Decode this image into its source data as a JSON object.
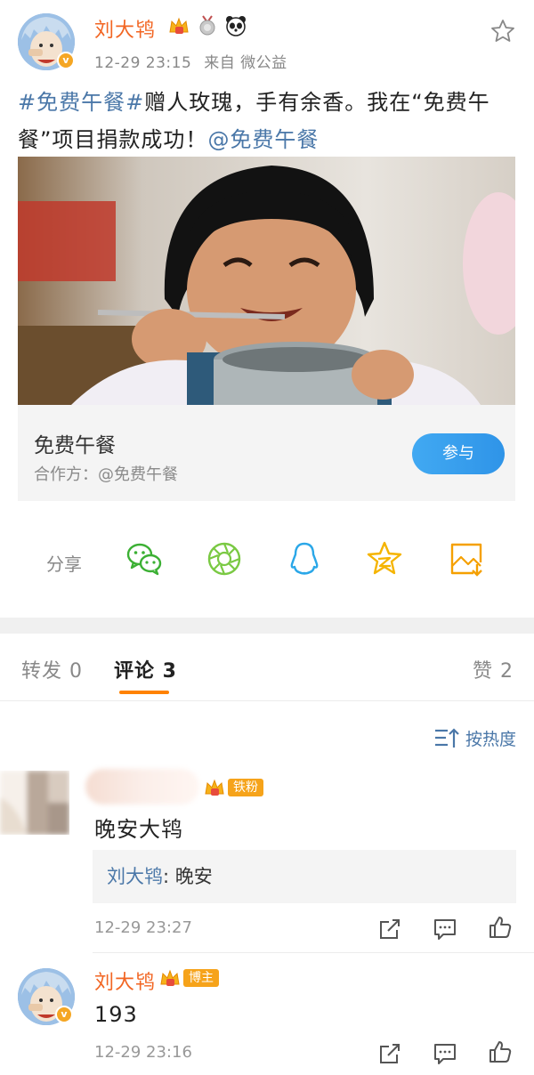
{
  "post": {
    "username": "刘大鸨",
    "time": "12-29 23:15",
    "source": "来自 微公益",
    "text_parts": {
      "tag": "#免费午餐#",
      "body": "赠人玫瑰，手有余香。我在“免费午餐”项目捐款成功！",
      "mention": "@免费午餐"
    }
  },
  "card": {
    "title": "免费午餐",
    "partner": "合作方：@免费午餐",
    "button_label": "参与"
  },
  "share": {
    "label": "分享",
    "icons": [
      "wechat-icon",
      "moments-icon",
      "qq-icon",
      "qzone-icon",
      "save-image-icon"
    ]
  },
  "tabs": {
    "repost": "转发 0",
    "comments": "评论 3",
    "likes": "赞 2"
  },
  "sort": {
    "label": "按热度"
  },
  "comments": [
    {
      "badge": "铁粉",
      "text": "晚安大鸨",
      "reply_author": "刘大鸨",
      "reply_text": ": 晚安",
      "time": "12-29 23:27"
    },
    {
      "username": "刘大鸨",
      "badge": "博主",
      "text": "193",
      "time": "12-29 23:16"
    }
  ],
  "colors": {
    "username": "#f26522",
    "link": "#4a77a8",
    "accent": "#ff8200",
    "button": "#3fa7f0"
  }
}
